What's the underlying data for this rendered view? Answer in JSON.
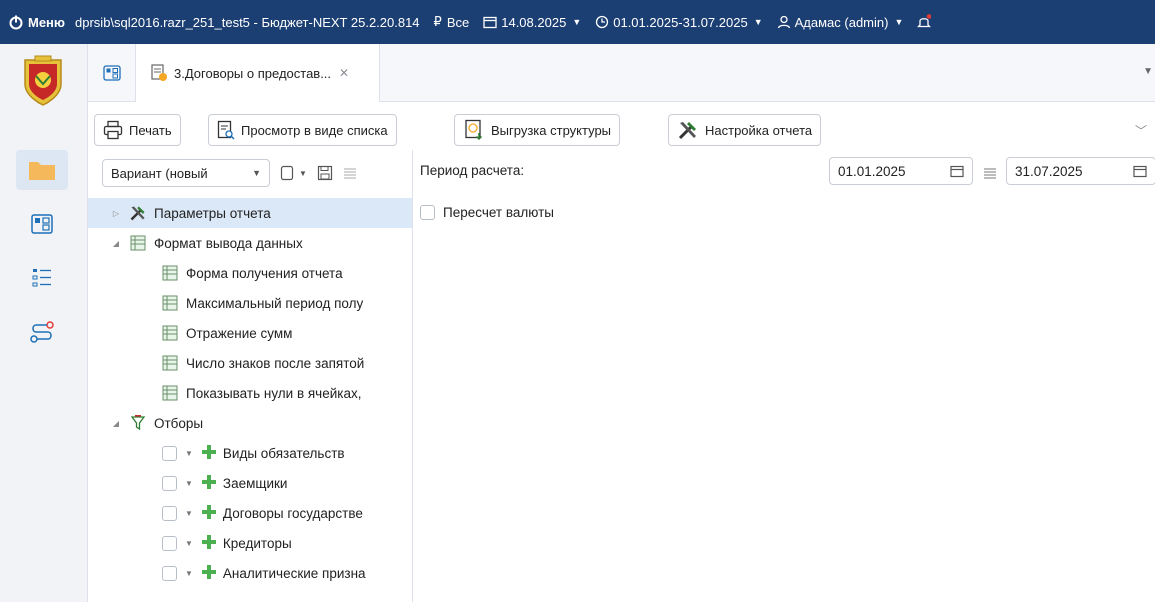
{
  "topbar": {
    "menu_label": "Меню",
    "connection": "dprsib\\sql2016.razr_251_test5 - Бюджет-NEXT 25.2.20.814",
    "currency": "Все",
    "date": "14.08.2025",
    "period": "01.01.2025-31.07.2025",
    "user": "Адамас (admin)"
  },
  "tabs": {
    "active_title": "3.Договоры о предостав..."
  },
  "toolbar": {
    "print": "Печать",
    "list_view": "Просмотр в виде списка",
    "export_structure": "Выгрузка структуры",
    "report_settings": "Настройка отчета"
  },
  "variant": {
    "value": "Вариант (новый"
  },
  "tree": {
    "report_params": "Параметры отчета",
    "output_format": "Формат вывода данных",
    "format_items": [
      "Форма получения отчета",
      "Максимальный период полу",
      "Отражение сумм",
      "Число знаков после запятой",
      "Показывать нули в ячейках, "
    ],
    "filters": "Отборы",
    "filter_items": [
      "Виды обязательств",
      "Заемщики",
      "Договоры государстве",
      "Кредиторы",
      "Аналитические призна"
    ]
  },
  "right": {
    "period_label": "Период расчета:",
    "date_from": "01.01.2025",
    "date_to": "31.07.2025",
    "currency_recalc": "Пересчет валюты"
  },
  "colors": {
    "topbar_bg": "#1c3f73",
    "selected_row": "#dbe8f7",
    "filter_plus": "#4caf50"
  }
}
